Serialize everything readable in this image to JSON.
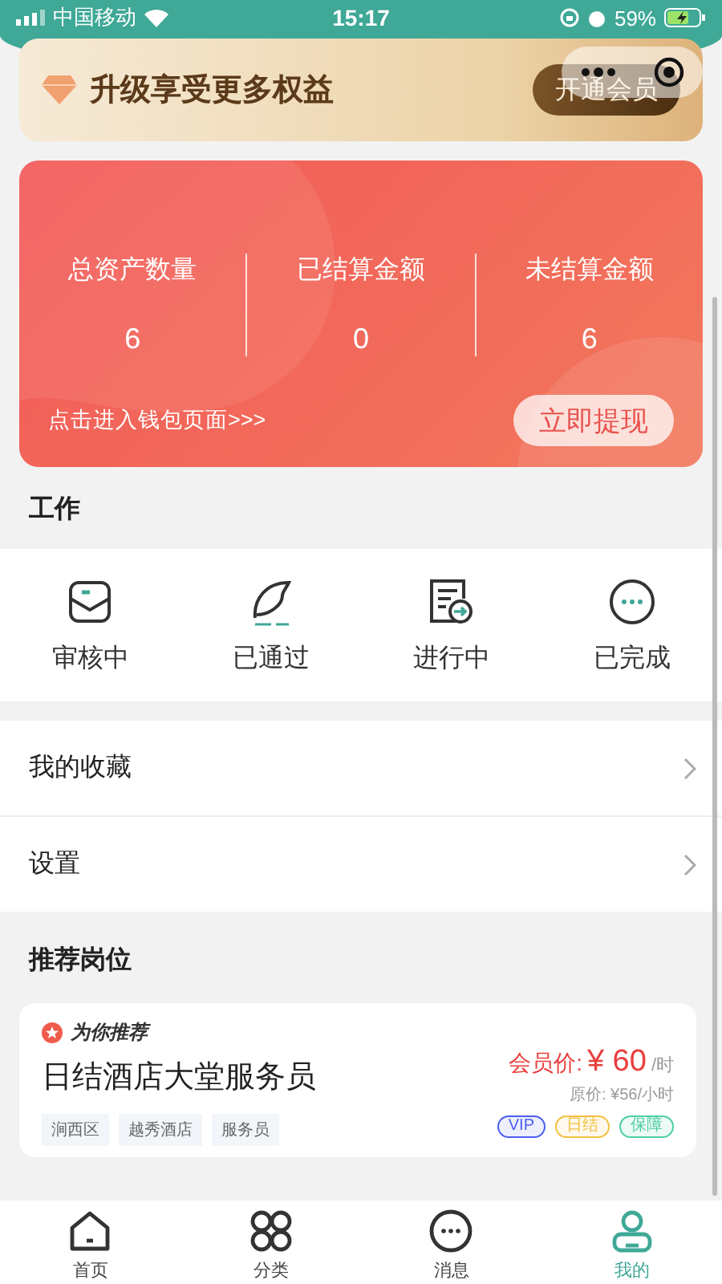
{
  "status_bar": {
    "carrier": "中国移动",
    "time": "15:17",
    "battery": "59%"
  },
  "vip_banner": {
    "title": "升级享受更多权益",
    "button": "开通会员"
  },
  "asset_card": {
    "stats": [
      {
        "label": "总资产数量",
        "value": "6"
      },
      {
        "label": "已结算金额",
        "value": "0"
      },
      {
        "label": "未结算金额",
        "value": "6"
      }
    ],
    "link": "点击进入钱包页面>>>",
    "button": "立即提现"
  },
  "work": {
    "heading": "工作",
    "items": [
      {
        "label": "审核中",
        "kind": "inbox"
      },
      {
        "label": "已通过",
        "kind": "feather"
      },
      {
        "label": "进行中",
        "kind": "document"
      },
      {
        "label": "已完成",
        "kind": "dots"
      }
    ]
  },
  "menu": [
    {
      "label": "我的收藏"
    },
    {
      "label": "设置"
    }
  ],
  "recommend": {
    "heading": "推荐岗位",
    "job": {
      "badge": "为你推荐",
      "title": "日结酒店大堂服务员",
      "price_label": "会员价:",
      "price": "¥ 60",
      "unit": "/时",
      "original_price": "原价: ¥56/小时",
      "tags": [
        "涧西区",
        "越秀酒店",
        "服务员"
      ],
      "labels": [
        {
          "text": "VIP",
          "color": "#4a5ef0"
        },
        {
          "text": "日结",
          "color": "#f2c040"
        },
        {
          "text": "保障",
          "color": "#4fcfa8"
        }
      ]
    }
  },
  "tab_bar": [
    {
      "label": "首页",
      "kind": "home",
      "selected": false
    },
    {
      "label": "分类",
      "kind": "clover",
      "selected": false
    },
    {
      "label": "消息",
      "kind": "chat",
      "selected": false
    },
    {
      "label": "我的",
      "kind": "person",
      "selected": true
    }
  ]
}
